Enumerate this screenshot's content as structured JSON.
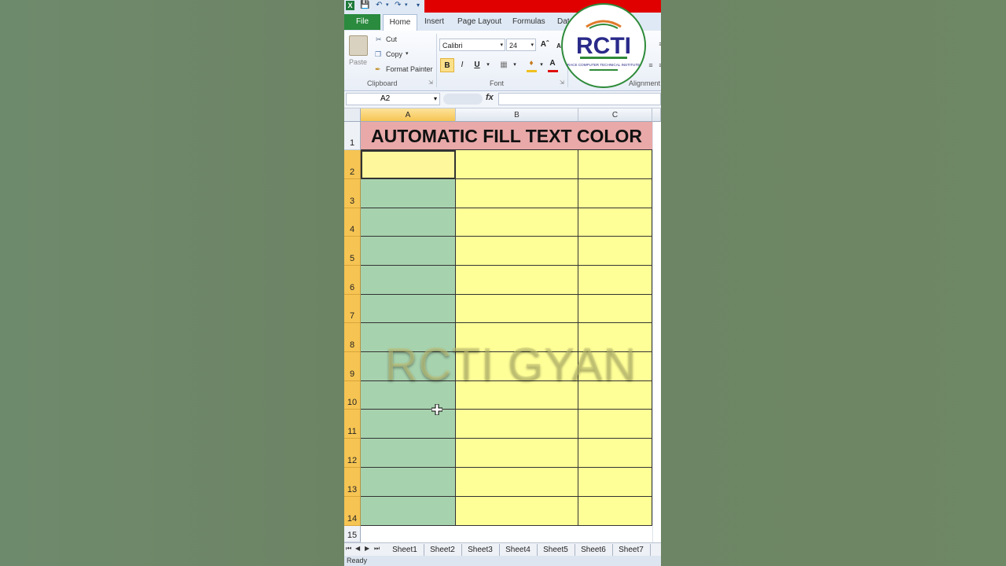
{
  "quick_access": {
    "app_icon": "X"
  },
  "tabs": [
    "File",
    "Home",
    "Insert",
    "Page Layout",
    "Formulas",
    "Data"
  ],
  "ribbon": {
    "clipboard": {
      "paste": "Paste",
      "cut": "Cut",
      "copy": "Copy",
      "format_painter": "Format Painter",
      "group_label": "Clipboard"
    },
    "font": {
      "font_name": "Calibri",
      "font_size": "24",
      "bold": "B",
      "italic": "I",
      "underline": "U",
      "group_label": "Font"
    },
    "alignment": {
      "group_label": "Alignment"
    }
  },
  "formula_bar": {
    "name_box": "A2",
    "fx": "fx",
    "value": ""
  },
  "columns": [
    "A",
    "B",
    "C"
  ],
  "rows": [
    "1",
    "2",
    "3",
    "4",
    "5",
    "6",
    "7",
    "8",
    "9",
    "10",
    "11",
    "12",
    "13",
    "14",
    "15"
  ],
  "sheet": {
    "title": "AUTOMATIC FILL TEXT COLOR"
  },
  "watermark": "RCTI GYAN",
  "sheet_tabs": [
    "Sheet1",
    "Sheet2",
    "Sheet3",
    "Sheet4",
    "Sheet5",
    "Sheet6",
    "Sheet7"
  ],
  "status": "Ready",
  "logo": {
    "text": "RCTI",
    "subtitle": "RACE COMPUTER TECHNICAL INSTITUTE"
  },
  "colors": {
    "title_fill": "#e8a9a8",
    "column_a_fill": "#a7d2ae",
    "yellow_fill": "#ffff98",
    "ribbon_red": "#e00000",
    "file_tab": "#2a8a3e"
  }
}
